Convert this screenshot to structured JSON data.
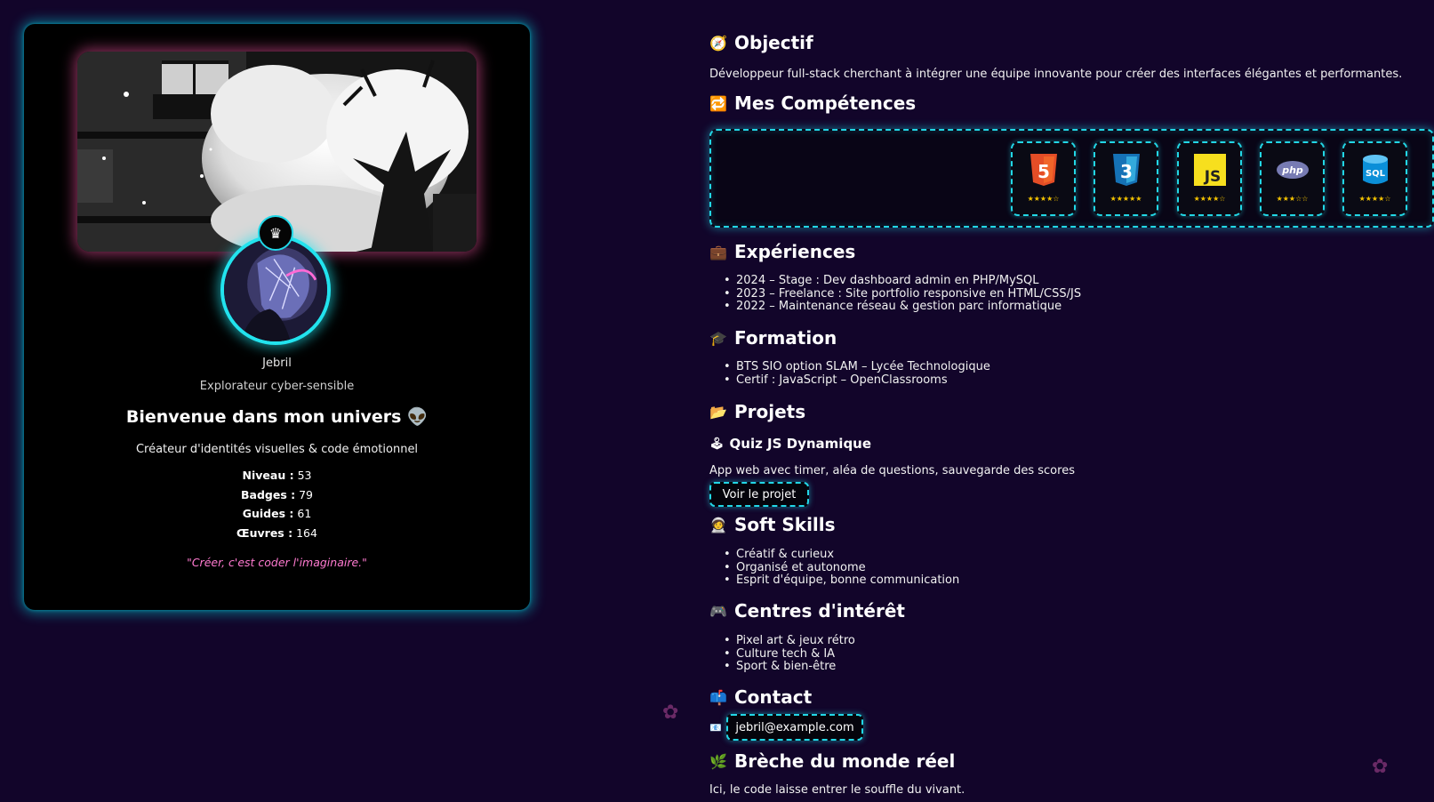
{
  "profile": {
    "name": "Jebril",
    "tagline": "Explorateur cyber-sensible",
    "welcome": "Bienvenue dans mon univers",
    "welcome_emoji": "👽",
    "subtitle": "Créateur d'identités visuelles & code émotionnel",
    "crown_icon": "♛",
    "stats": [
      {
        "label": "Niveau :",
        "value": "53"
      },
      {
        "label": "Badges :",
        "value": "79"
      },
      {
        "label": "Guides :",
        "value": "61"
      },
      {
        "label": "Œuvres :",
        "value": "164"
      }
    ],
    "quote": "\"Créer, c'est coder l'imaginaire.\""
  },
  "sections": {
    "objectif": {
      "icon": "🧭",
      "title": "Objectif",
      "text": "Développeur full-stack cherchant à intégrer une équipe innovante pour créer des interfaces élégantes et performantes."
    },
    "competences": {
      "icon": "🔁",
      "title": "Mes Compétences"
    },
    "experiences": {
      "icon": "💼",
      "title": "Expériences",
      "items": [
        "2024 – Stage : Dev dashboard admin en PHP/MySQL",
        "2023 – Freelance : Site portfolio responsive en HTML/CSS/JS",
        "2022 – Maintenance réseau & gestion parc informatique"
      ]
    },
    "formation": {
      "icon": "🎓",
      "title": "Formation",
      "items": [
        "BTS SIO option SLAM – Lycée Technologique",
        "Certif : JavaScript – OpenClassrooms"
      ]
    },
    "projets": {
      "icon": "📂",
      "title": "Projets",
      "project": {
        "icon": "🕹",
        "title": "Quiz JS Dynamique",
        "description": "App web avec timer, aléa de questions, sauvegarde des scores",
        "button": "Voir le projet"
      }
    },
    "soft": {
      "icon": "🧑‍🚀",
      "title": "Soft Skills",
      "items": [
        "Créatif & curieux",
        "Organisé et autonome",
        "Esprit d'équipe, bonne communication"
      ]
    },
    "interets": {
      "icon": "🎮",
      "title": "Centres d'intérêt",
      "items": [
        "Pixel art & jeux rétro",
        "Culture tech & IA",
        "Sport & bien-être"
      ]
    },
    "contact": {
      "icon": "📫",
      "title": "Contact",
      "mail_icon": "📧",
      "email": "jebril@example.com"
    },
    "breche": {
      "icon": "🌿",
      "title": "Brèche du monde réel",
      "text": "Ici, le code laisse entrer le souffle du vivant."
    }
  },
  "skills": [
    {
      "name": "HTML5",
      "icon": "html5-icon",
      "rating": 4,
      "stars": "★★★★☆",
      "color": "#e44d26"
    },
    {
      "name": "CSS3",
      "icon": "css3-icon",
      "rating": 5,
      "stars": "★★★★★",
      "color": "#1572b6"
    },
    {
      "name": "JS",
      "icon": "js-icon",
      "rating": 4,
      "stars": "★★★★☆",
      "color": "#f7df1e"
    },
    {
      "name": "php",
      "icon": "php-icon",
      "rating": 3,
      "stars": "★★★☆☆",
      "color": "#777bb3"
    },
    {
      "name": "SQL",
      "icon": "sql-database-icon",
      "rating": 4,
      "stars": "★★★★☆",
      "color": "#0b8fd8"
    }
  ],
  "decor": {
    "flower": "✿"
  },
  "colors": {
    "background": "#12052a",
    "neon_cyan": "#22d7e6",
    "neon_pink": "#ff7ad0",
    "star_gold": "#f5c400"
  }
}
